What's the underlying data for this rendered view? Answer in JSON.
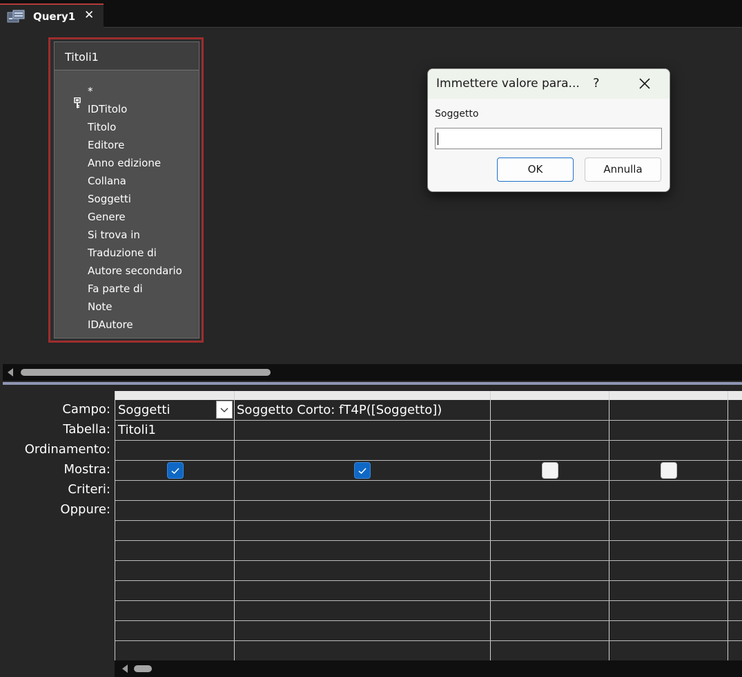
{
  "tab": {
    "title": "Query1",
    "close_glyph": "✕",
    "icon": "query-icon"
  },
  "table_box": {
    "title": "Titoli1",
    "fields": [
      "*",
      "IDTitolo",
      "Titolo",
      "Editore",
      "Anno edizione",
      "Collana",
      "Soggetti",
      "Genere",
      "Si trova in",
      "Traduzione di",
      "Autore secondario",
      "Fa parte di",
      "Note",
      "IDAutore"
    ],
    "key_field": "IDTitolo",
    "key_icon": "primary-key-icon"
  },
  "grid": {
    "row_labels": {
      "campo": "Campo:",
      "tabella": "Tabella:",
      "ordinamento": "Ordinamento:",
      "mostra": "Mostra:",
      "criteri": "Criteri:",
      "oppure": "Oppure:"
    },
    "columns": [
      {
        "campo": "Soggetti",
        "tabella": "Titoli1",
        "mostra": true
      },
      {
        "campo": "Soggetto Corto: fT4P([Soggetto])",
        "tabella": "",
        "mostra": true
      },
      {
        "campo": "",
        "tabella": "",
        "mostra": false
      },
      {
        "campo": "",
        "tabella": "",
        "mostra": false
      }
    ]
  },
  "dialog": {
    "title": "Immettere valore para...",
    "help_glyph": "?",
    "close_icon": "close-icon",
    "prompt_label": "Soggetto",
    "input_value": "",
    "ok_label": "OK",
    "cancel_label": "Annulla"
  },
  "colors": {
    "accent_tab": "#b43a3a",
    "table_box_border": "#9e2d2d",
    "checkbox_checked": "#0f68c6",
    "ok_button_border": "#1f6fc9"
  }
}
